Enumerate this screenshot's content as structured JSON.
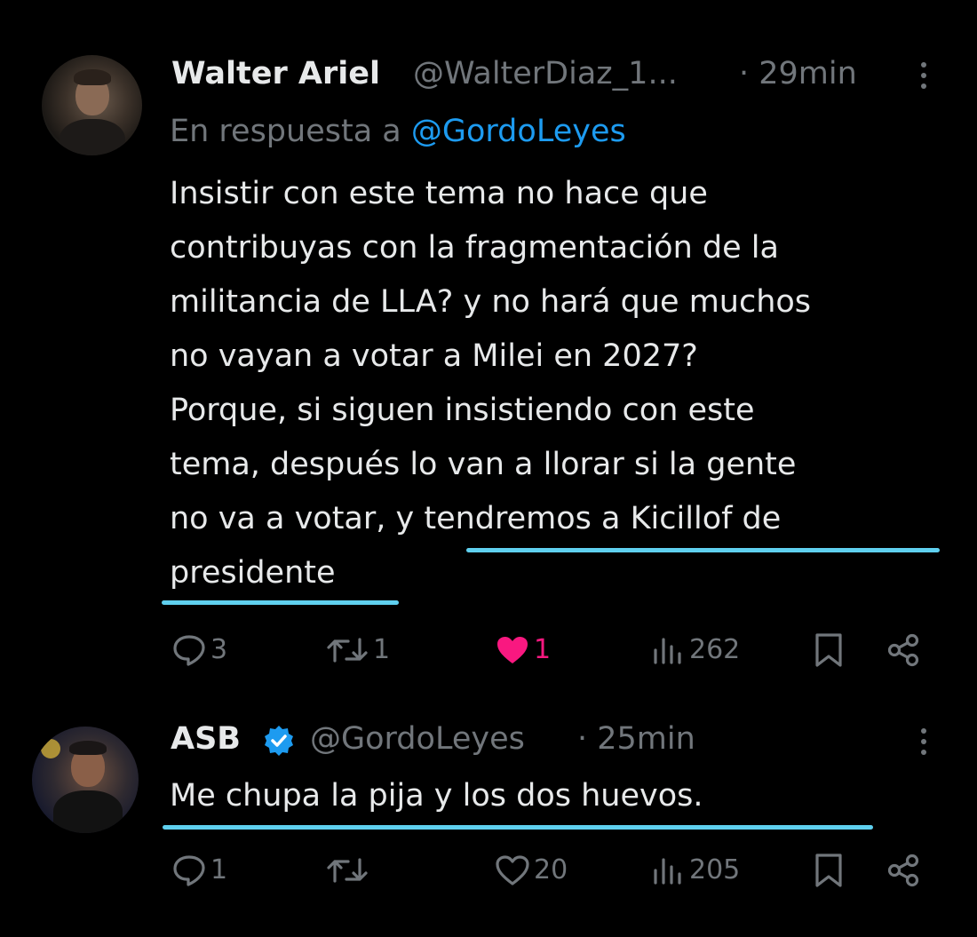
{
  "tweets": [
    {
      "author": "Walter Ariel",
      "handle": "@WalterDiaz_1...",
      "time": "· 29min",
      "reply_prefix": "En respuesta a",
      "reply_to": "@GordoLeyes",
      "lines": [
        "Insistir con este tema no hace que",
        "contribuyas con la fragmentación de la",
        "militancia de LLA? y no hará que muchos",
        "no vayan a votar a Milei en 2027?",
        "Porque, si siguen insistiendo con este",
        "tema, después lo van a llorar si la gente",
        "no va a votar, y tendremos a Kicillof de",
        "presidente"
      ],
      "replies": "3",
      "reposts": "1",
      "likes": "1",
      "liked": true,
      "views": "262"
    },
    {
      "author": "ASB",
      "verified": true,
      "handle": "@GordoLeyes",
      "time": "· 25min",
      "lines": [
        "Me chupa la pija y los dos huevos."
      ],
      "replies": "1",
      "reposts": "",
      "likes": "20",
      "liked": false,
      "views": "205"
    }
  ],
  "icons": {
    "reply": "speech-bubble-icon",
    "repost": "repost-arrows-icon",
    "like": "heart-icon",
    "views": "bar-chart-icon",
    "bookmark": "bookmark-icon",
    "share": "share-nodes-icon",
    "more": "three-dots-vertical-icon",
    "verified": "verified-badge-icon"
  },
  "colors": {
    "background": "#000000",
    "text": "#e7e9ea",
    "muted": "#71767b",
    "link": "#1d9bf0",
    "like_active": "#f91880",
    "verified": "#1d9bf0",
    "highlight_underline": "#5fd0ef"
  }
}
